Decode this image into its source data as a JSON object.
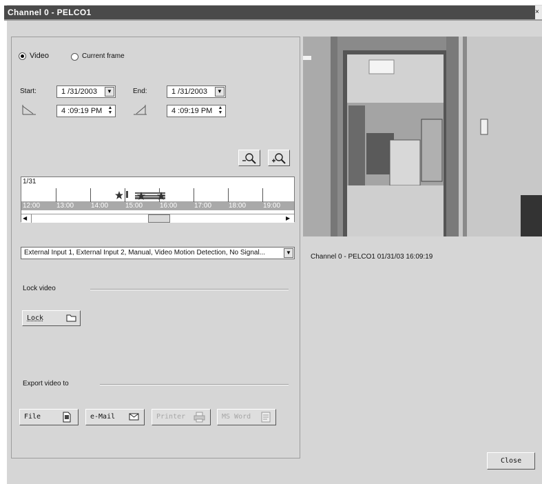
{
  "window": {
    "title": "Channel 0 - PELCO1",
    "close_glyph": "×"
  },
  "mode": {
    "video_label": "Video",
    "current_frame_label": "Current frame",
    "selected": "video"
  },
  "range": {
    "start_label": "Start:",
    "end_label": "End:",
    "start_date": "1 /31/2003",
    "start_time": "4 :09:19 PM",
    "end_date": "1 /31/2003",
    "end_time": "4 :09:19 PM"
  },
  "timeline": {
    "date_label": "1/31",
    "hours": [
      "12:00",
      "13:00",
      "14:00",
      "15:00",
      "16:00",
      "17:00",
      "18:00",
      "19:00"
    ],
    "scroll_position_fraction": 0.46
  },
  "zoom": {
    "zoom_out_icon": "zoom-out-icon",
    "zoom_in_icon": "zoom-in-icon"
  },
  "event_filter": {
    "value": "External Input 1, External Input 2, Manual, Video Motion Detection, No Signal..."
  },
  "lock": {
    "section_label": "Lock video",
    "button_label": "Lock"
  },
  "export": {
    "section_label": "Export video to",
    "buttons": [
      {
        "label": "File",
        "enabled": true,
        "icon": "file-icon"
      },
      {
        "label": "e-Mail",
        "enabled": true,
        "icon": "envelope-icon"
      },
      {
        "label": "Printer",
        "enabled": false,
        "icon": "printer-icon"
      },
      {
        "label": "MS Word",
        "enabled": false,
        "icon": "word-document-icon"
      }
    ]
  },
  "preview": {
    "caption": "Channel 0 - PELCO1 01/31/03 16:09:19"
  },
  "footer": {
    "close_label": "Close"
  },
  "colors": {
    "titlebar": "#4a4a4a",
    "dialog_bg": "#d6d6d6",
    "timeline_band": "#a9a9a9"
  }
}
